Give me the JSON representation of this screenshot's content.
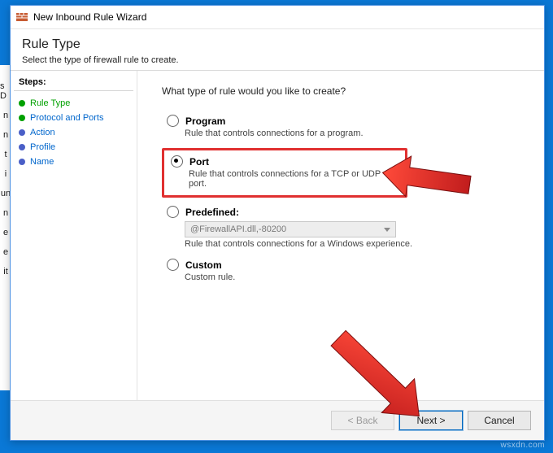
{
  "window": {
    "title": "New Inbound Rule Wizard"
  },
  "header": {
    "title": "Rule Type",
    "subtitle": "Select the type of firewall rule to create."
  },
  "steps": {
    "heading": "Steps:",
    "items": [
      {
        "label": "Rule Type",
        "state": "done"
      },
      {
        "label": "Protocol and Ports",
        "state": "done"
      },
      {
        "label": "Action",
        "state": "pending"
      },
      {
        "label": "Profile",
        "state": "pending"
      },
      {
        "label": "Name",
        "state": "pending"
      }
    ]
  },
  "content": {
    "prompt": "What type of rule would you like to create?",
    "options": {
      "program": {
        "label": "Program",
        "desc": "Rule that controls connections for a program."
      },
      "port": {
        "label": "Port",
        "desc": "Rule that controls connections for a TCP or UDP port."
      },
      "predefined": {
        "label": "Predefined:",
        "select_value": "@FirewallAPI.dll,-80200",
        "desc": "Rule that controls connections for a Windows experience."
      },
      "custom": {
        "label": "Custom",
        "desc": "Custom rule."
      }
    },
    "selected": "port"
  },
  "buttons": {
    "back": "< Back",
    "next": "Next >",
    "cancel": "Cancel"
  },
  "watermark": "wsxdn.com"
}
